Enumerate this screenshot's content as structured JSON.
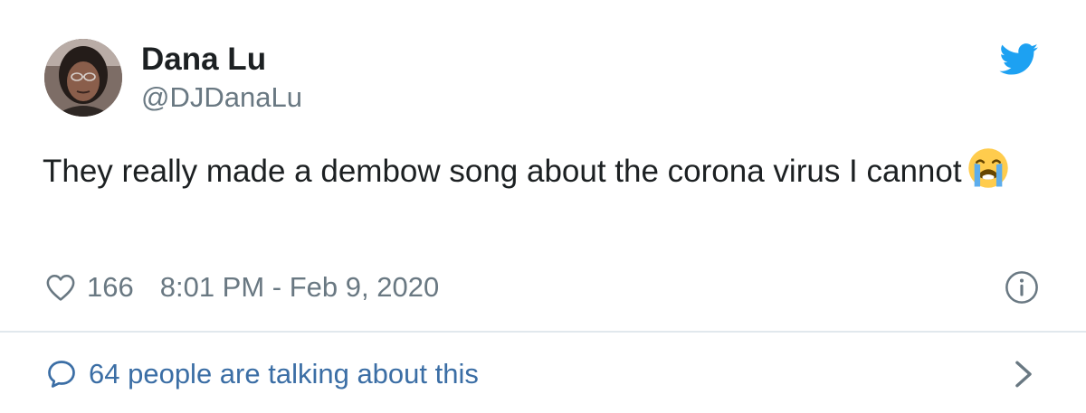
{
  "author": {
    "display_name": "Dana Lu",
    "handle": "@DJDanaLu",
    "avatar_icon": "user-avatar-photo"
  },
  "tweet": {
    "text": "They really made a dembow song about the corona virus I cannot",
    "emoji_icon": "loudly-crying-face-emoji"
  },
  "meta": {
    "like_count": "166",
    "timestamp": "8:01 PM - Feb 9, 2020",
    "like_icon": "heart-icon",
    "info_icon": "info-icon"
  },
  "conversation": {
    "label": "64 people are talking about this",
    "icon": "speech-bubble-icon",
    "chevron_icon": "chevron-right-icon"
  },
  "colors": {
    "brand": "#1da1f2",
    "text": "#1c2022",
    "secondary": "#697882",
    "link": "#3b6ea5",
    "divider": "#e1e8ed"
  }
}
